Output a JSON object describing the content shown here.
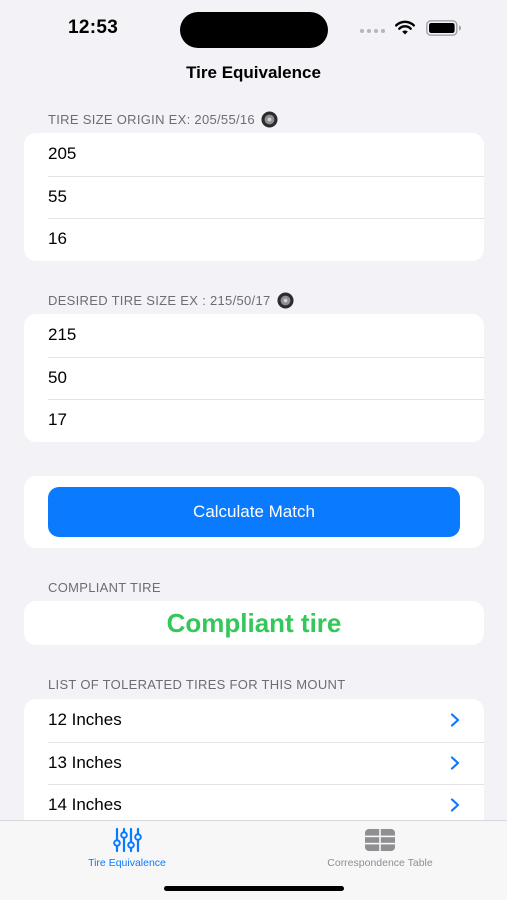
{
  "status_bar": {
    "time": "12:53"
  },
  "nav": {
    "title": "Tire Equivalence"
  },
  "origin": {
    "header": "TIRE SIZE ORIGIN EX: 205/55/16",
    "width": "205",
    "aspect": "55",
    "rim": "16"
  },
  "desired": {
    "header": "DESIRED TIRE SIZE EX : 215/50/17",
    "width": "215",
    "aspect": "50",
    "rim": "17"
  },
  "calculate": {
    "label": "Calculate Match"
  },
  "compliance": {
    "header": "COMPLIANT TIRE",
    "result": "Compliant tire",
    "result_color": "#34c759"
  },
  "tolerated": {
    "header": "LIST OF TOLERATED TIRES FOR THIS MOUNT",
    "items": [
      {
        "label": "12 Inches"
      },
      {
        "label": "13 Inches"
      },
      {
        "label": "14 Inches"
      }
    ]
  },
  "tabs": [
    {
      "label": "Tire Equivalence",
      "icon": "sliders-icon",
      "active": true
    },
    {
      "label": "Correspondence Table",
      "icon": "table-icon",
      "active": false
    }
  ],
  "colors": {
    "accent": "#0a7aff",
    "background": "#f2f2f7",
    "inactive_tab": "#8e8e93"
  }
}
